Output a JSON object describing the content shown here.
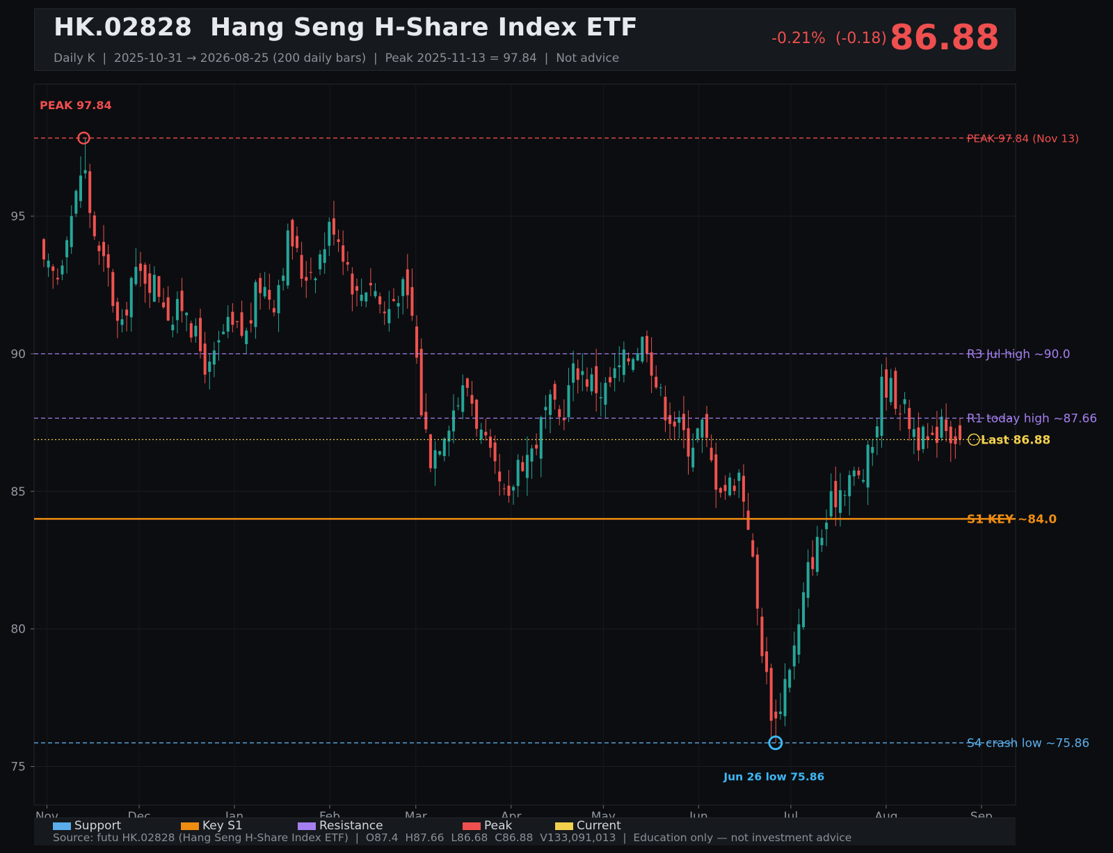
{
  "header": {
    "title": "HK.02828  Hang Seng H-Share Index ETF",
    "subtitle": "Daily K  |  2025-10-31 → 2026-08-25 (200 daily bars)  |  Peak 2025-11-13 = 97.84  |  Not advice",
    "change": "-0.21%  (-0.18)",
    "price": "86.88"
  },
  "colors": {
    "up": "#26a69a",
    "down": "#ef5350",
    "support": "#5aaeea",
    "key_s1": "#ef8c12",
    "resistance": "#a57ff0",
    "peak": "#ef4f4f",
    "current": "#f2cf4d",
    "crash_low_label": "#3db7f5"
  },
  "chart_data": {
    "type": "candlestick",
    "x_start": "2025-10-31",
    "x_end": "2026-08-25",
    "bar_count": 200,
    "x_tick_labels": [
      "Nov",
      "Dec",
      "Jan",
      "Feb",
      "Mar",
      "Apr",
      "May",
      "Jun",
      "Jul",
      "Aug",
      "Sep"
    ],
    "x_tick_dates": [
      "2025-11-01",
      "2025-12-01",
      "2026-01-01",
      "2026-02-01",
      "2026-03-01",
      "2026-04-01",
      "2026-05-01",
      "2026-06-01",
      "2026-07-01",
      "2026-08-01",
      "2026-09-01"
    ],
    "y_ticks": [
      75,
      80,
      85,
      90,
      95
    ],
    "ylim": [
      73.6,
      99.8
    ],
    "grid": true,
    "close_path": [
      [
        "2025-10-31",
        93.0
      ],
      [
        "2025-11-05",
        92.8
      ],
      [
        "2025-11-07",
        94.5
      ],
      [
        "2025-11-10",
        95.4
      ],
      [
        "2025-11-13",
        97.2
      ],
      [
        "2025-11-14",
        95.8
      ],
      [
        "2025-11-18",
        93.5
      ],
      [
        "2025-11-21",
        92.9
      ],
      [
        "2025-11-25",
        90.4
      ],
      [
        "2025-11-28",
        92.7
      ],
      [
        "2025-12-03",
        92.9
      ],
      [
        "2025-12-08",
        92.3
      ],
      [
        "2025-12-12",
        91.2
      ],
      [
        "2025-12-16",
        92.0
      ],
      [
        "2025-12-19",
        90.6
      ],
      [
        "2025-12-24",
        89.3
      ],
      [
        "2025-12-29",
        90.9
      ],
      [
        "2026-01-05",
        90.7
      ],
      [
        "2026-01-09",
        92.6
      ],
      [
        "2026-01-14",
        92.0
      ],
      [
        "2026-01-19",
        94.4
      ],
      [
        "2026-01-23",
        92.9
      ],
      [
        "2026-01-28",
        93.3
      ],
      [
        "2026-02-02",
        94.9
      ],
      [
        "2026-02-06",
        93.6
      ],
      [
        "2026-02-10",
        92.0
      ],
      [
        "2026-02-14",
        92.8
      ],
      [
        "2026-02-19",
        91.4
      ],
      [
        "2026-02-24",
        92.5
      ],
      [
        "2026-02-28",
        91.3
      ],
      [
        "2026-03-03",
        87.8
      ],
      [
        "2026-03-06",
        86.2
      ],
      [
        "2026-03-10",
        87.3
      ],
      [
        "2026-03-14",
        88.2
      ],
      [
        "2026-03-18",
        88.9
      ],
      [
        "2026-03-22",
        87.1
      ],
      [
        "2026-03-27",
        85.5
      ],
      [
        "2026-03-31",
        84.3
      ],
      [
        "2026-04-03",
        86.1
      ],
      [
        "2026-04-08",
        86.5
      ],
      [
        "2026-04-13",
        88.1
      ],
      [
        "2026-04-17",
        87.6
      ],
      [
        "2026-04-22",
        89.6
      ],
      [
        "2026-04-27",
        89.0
      ],
      [
        "2026-05-01",
        88.6
      ],
      [
        "2026-05-06",
        89.4
      ],
      [
        "2026-05-11",
        90.2
      ],
      [
        "2026-05-15",
        90.6
      ],
      [
        "2026-05-19",
        88.5
      ],
      [
        "2026-05-24",
        87.6
      ],
      [
        "2026-05-29",
        86.7
      ],
      [
        "2026-06-02",
        87.4
      ],
      [
        "2026-06-06",
        85.6
      ],
      [
        "2026-06-10",
        85.1
      ],
      [
        "2026-06-14",
        85.7
      ],
      [
        "2026-06-17",
        84.1
      ],
      [
        "2026-06-20",
        80.8
      ],
      [
        "2026-06-24",
        77.4
      ],
      [
        "2026-06-26",
        76.6
      ],
      [
        "2026-06-30",
        78.6
      ],
      [
        "2026-07-03",
        79.6
      ],
      [
        "2026-07-07",
        82.4
      ],
      [
        "2026-07-11",
        83.4
      ],
      [
        "2026-07-15",
        84.8
      ],
      [
        "2026-07-20",
        85.6
      ],
      [
        "2026-07-24",
        85.4
      ],
      [
        "2026-07-28",
        86.9
      ],
      [
        "2026-07-31",
        89.1
      ],
      [
        "2026-08-04",
        88.5
      ],
      [
        "2026-08-08",
        87.7
      ],
      [
        "2026-08-12",
        86.9
      ],
      [
        "2026-08-16",
        86.6
      ],
      [
        "2026-08-19",
        87.9
      ],
      [
        "2026-08-22",
        87.2
      ],
      [
        "2026-08-25",
        86.88
      ]
    ],
    "last_bar": {
      "open": 87.4,
      "high": 87.66,
      "low": 86.68,
      "close": 86.88,
      "volume": 133091013
    },
    "peak": {
      "date": "2025-11-13",
      "value": 97.84
    },
    "crash_low": {
      "date": "2026-06-26",
      "value": 75.86
    },
    "levels": [
      {
        "kind": "peak",
        "value": 97.84,
        "label": "PEAK 97.84 (Nov 13)",
        "style": "dashed"
      },
      {
        "kind": "resistance",
        "value": 90.0,
        "label": "R3 Jul high ~90.0",
        "style": "dashed"
      },
      {
        "kind": "resistance",
        "value": 87.66,
        "label": "R1 today high ~87.66",
        "style": "dashed"
      },
      {
        "kind": "current",
        "value": 86.88,
        "label": "Last 86.88",
        "style": "dotted"
      },
      {
        "kind": "key_s1",
        "value": 84.0,
        "label": "S1 KEY ~84.0",
        "style": "solid"
      },
      {
        "kind": "support",
        "value": 75.86,
        "label": "S4 crash low ~75.86",
        "style": "dashed"
      }
    ],
    "annotations": {
      "peak_label": "PEAK 97.84",
      "low_label": "Jun 26 low 75.86"
    }
  },
  "legend": [
    {
      "label": "Support",
      "color": "#5aaeea"
    },
    {
      "label": "Key S1",
      "color": "#ef8c12"
    },
    {
      "label": "Resistance",
      "color": "#a57ff0"
    },
    {
      "label": "Peak",
      "color": "#ef4f4f"
    },
    {
      "label": "Current",
      "color": "#f2cf4d"
    }
  ],
  "footer": {
    "source": "Source: futu HK.02828 (Hang Seng H-Share Index ETF)  |  O87.4  H87.66  L86.68  C86.88  V133,091,013  |  Education only — not investment advice"
  }
}
